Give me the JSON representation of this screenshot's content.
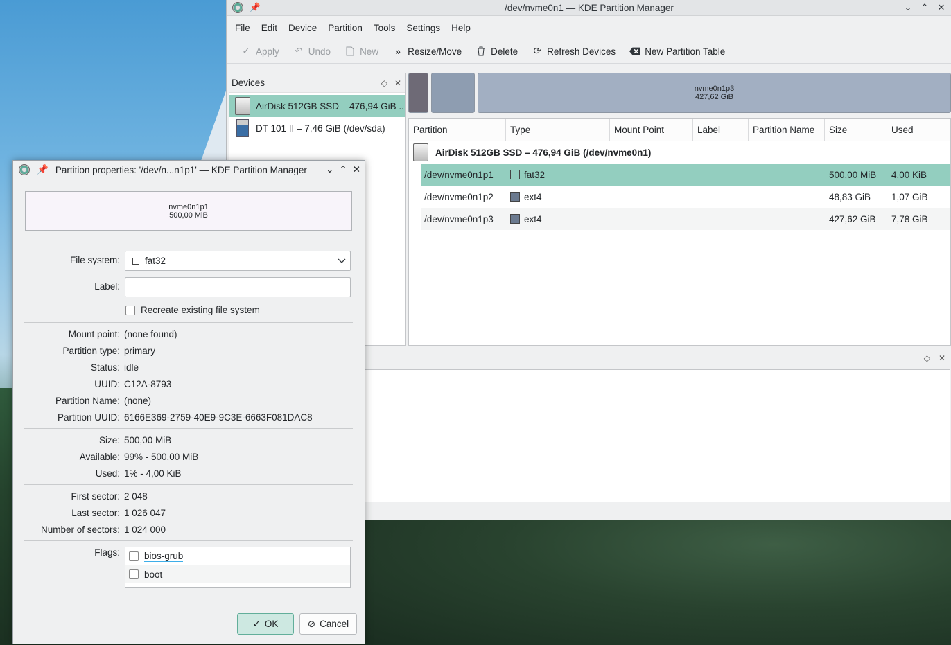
{
  "main_window": {
    "title": "/dev/nvme0n1 — KDE Partition Manager",
    "menu": [
      "File",
      "Edit",
      "Device",
      "Partition",
      "Tools",
      "Settings",
      "Help"
    ],
    "toolbar": {
      "apply": "Apply",
      "undo": "Undo",
      "new": "New",
      "resize_move": "Resize/Move",
      "delete": "Delete",
      "refresh": "Refresh Devices",
      "new_table": "New Partition Table"
    }
  },
  "devices_panel": {
    "title": "Devices",
    "items": [
      {
        "label": "AirDisk 512GB SSD – 476,94 GiB ...",
        "selected": true
      },
      {
        "label": "DT 101 II – 7,46 GiB (/dev/sda)",
        "selected": false
      }
    ]
  },
  "partition_graph": {
    "large_segment": {
      "name": "nvme0n1p3",
      "size": "427,62 GiB"
    }
  },
  "partition_table": {
    "headers": [
      "Partition",
      "Type",
      "Mount Point",
      "Label",
      "Partition Name",
      "Size",
      "Used"
    ],
    "device_row": "AirDisk 512GB SSD – 476,94 GiB (/dev/nvme0n1)",
    "rows": [
      {
        "partition": "/dev/nvme0n1p1",
        "type": "fat32",
        "type_color": "#4a4a4a",
        "size": "500,00 MiB",
        "used": "4,00 KiB"
      },
      {
        "partition": "/dev/nvme0n1p2",
        "type": "ext4",
        "type_color": "#6b7a8f",
        "size": "48,83 GiB",
        "used": "1,07 GiB"
      },
      {
        "partition": "/dev/nvme0n1p3",
        "type": "ext4",
        "type_color": "#6b7a8f",
        "size": "427,62 GiB",
        "used": "7,78 GiB"
      }
    ]
  },
  "dialog": {
    "title": "Partition properties: '/dev/n...n1p1' — KDE Partition Manager",
    "preview": {
      "name": "nvme0n1p1",
      "size": "500,00 MiB"
    },
    "file_system_label": "File system:",
    "file_system_value": "fat32",
    "label_label": "Label:",
    "recreate_label": "Recreate existing file system",
    "info": [
      {
        "label": "Mount point:",
        "value": "(none found)"
      },
      {
        "label": "Partition type:",
        "value": "primary"
      },
      {
        "label": "Status:",
        "value": "idle"
      },
      {
        "label": "UUID:",
        "value": "C12A-8793"
      },
      {
        "label": "Partition Name:",
        "value": "(none)"
      },
      {
        "label": "Partition UUID:",
        "value": "6166E369-2759-40E9-9C3E-6663F081DAC8"
      }
    ],
    "size_info": [
      {
        "label": "Size:",
        "value": "500,00 MiB"
      },
      {
        "label": "Available:",
        "value": "99% - 500,00 MiB"
      },
      {
        "label": "Used:",
        "value": "1% - 4,00 KiB"
      }
    ],
    "sector_info": [
      {
        "label": "First sector:",
        "value": "2 048"
      },
      {
        "label": "Last sector:",
        "value": "1 026 047"
      },
      {
        "label": "Number of sectors:",
        "value": "1 024 000"
      }
    ],
    "flags_label": "Flags:",
    "flags": [
      "bios-grub",
      "boot"
    ],
    "ok": "OK",
    "cancel": "Cancel"
  }
}
